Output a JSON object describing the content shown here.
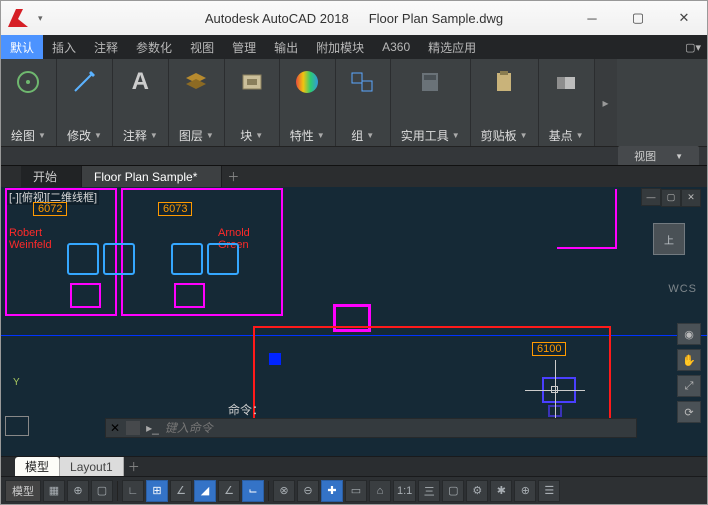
{
  "title": {
    "app": "Autodesk AutoCAD 2018",
    "file": "Floor Plan Sample.dwg"
  },
  "menu": {
    "items": [
      "默认",
      "插入",
      "注释",
      "参数化",
      "视图",
      "管理",
      "输出",
      "附加模块",
      "A360",
      "精选应用"
    ],
    "active_index": 0
  },
  "ribbon": {
    "panels": [
      {
        "label": "绘图"
      },
      {
        "label": "修改"
      },
      {
        "label": "注释"
      },
      {
        "label": "图层"
      },
      {
        "label": "块"
      },
      {
        "label": "特性"
      },
      {
        "label": "组"
      },
      {
        "label": "实用工具"
      },
      {
        "label": "剪贴板"
      },
      {
        "label": "基点"
      }
    ],
    "footer": "视图"
  },
  "file_tabs": {
    "start": "开始",
    "active": "Floor Plan Sample*"
  },
  "drawing": {
    "viewport_label": "[-][俯视][二维线框]",
    "room_6072": "6072",
    "room_6073": "6073",
    "room_6100": "6100",
    "person1": "Robert\nWeinfeld",
    "person2": "Arnold\nGreen",
    "ucs_y": "Y",
    "wcs": "WCS",
    "cube_face": "上"
  },
  "command": {
    "label": "命令：",
    "placeholder": "键入命令",
    "cross": "✕"
  },
  "layout_tabs": {
    "model": "模型",
    "layout1": "Layout1"
  },
  "status": {
    "model": "模型",
    "scale": "1:1",
    "icons": [
      "▦",
      "⊕",
      "▢",
      "∟",
      "⊞",
      "∠",
      "◢",
      "∠",
      "⌙",
      "⊗",
      "⊖",
      "✚",
      "▭",
      "⌂",
      "三",
      "▢",
      "⚙",
      "✱",
      "⊕",
      "☰"
    ]
  }
}
